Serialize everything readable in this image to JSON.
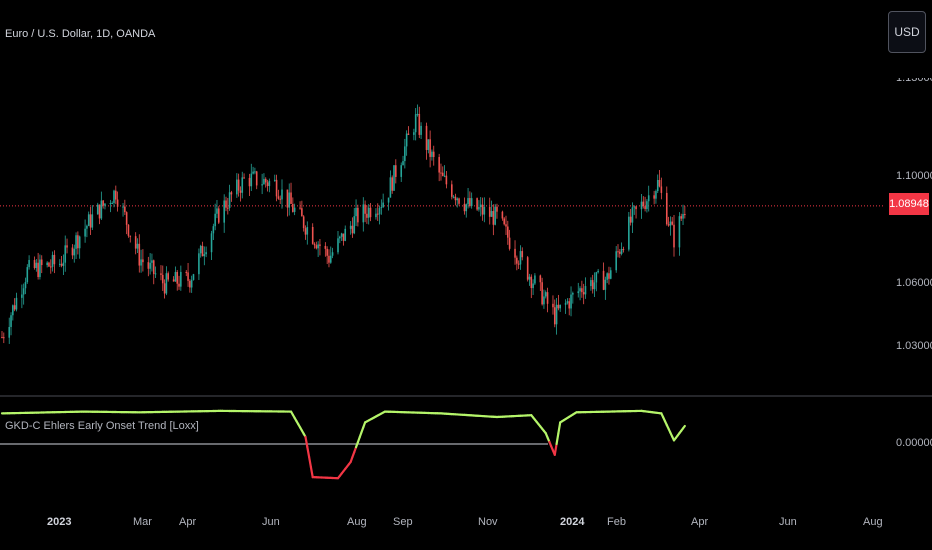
{
  "header": {
    "symbol_title": "Euro / U.S. Dollar, 1D, OANDA",
    "currency_button": "USD"
  },
  "price_pane": {
    "last_price_label": "1.08948",
    "y_axis_ticks": [
      "1.10000",
      "1.06000",
      "1.03000"
    ],
    "partially_visible_top_tick": "1.13000"
  },
  "indicator_pane": {
    "title": "GKD-C Ehlers Early Onset Trend [Loxx]",
    "y_axis_ticks": [
      "0.00000"
    ]
  },
  "time_axis": {
    "labels": [
      "2023",
      "Mar",
      "Apr",
      "Jun",
      "Aug",
      "Sep",
      "Nov",
      "2024",
      "Feb",
      "Apr",
      "Jun",
      "Aug"
    ]
  },
  "colors": {
    "background": "#000000",
    "up_candle": "#26a69a",
    "down_candle": "#ef5350",
    "price_line": "#f23645",
    "trend_up": "#b5f56a",
    "trend_down": "#f23645",
    "pane_divider": "#d1d4dc"
  },
  "chart_data": [
    {
      "type": "candlestick",
      "title": "Euro / U.S. Dollar, 1D, OANDA",
      "x_range": [
        "2022-12",
        "2023-12"
      ],
      "y_range": [
        1.02,
        1.13
      ],
      "last_price": 1.08948,
      "close_path": [
        [
          "2022-12-01",
          1.04
        ],
        [
          "2022-12-15",
          1.065
        ],
        [
          "2023-01-02",
          1.068
        ],
        [
          "2023-01-20",
          1.085
        ],
        [
          "2023-02-02",
          1.095
        ],
        [
          "2023-02-15",
          1.07
        ],
        [
          "2023-03-01",
          1.06
        ],
        [
          "2023-03-15",
          1.062
        ],
        [
          "2023-04-01",
          1.088
        ],
        [
          "2023-04-15",
          1.1
        ],
        [
          "2023-05-01",
          1.098
        ],
        [
          "2023-05-15",
          1.085
        ],
        [
          "2023-05-31",
          1.07
        ],
        [
          "2023-06-15",
          1.085
        ],
        [
          "2023-07-01",
          1.092
        ],
        [
          "2023-07-18",
          1.122
        ],
        [
          "2023-08-01",
          1.1
        ],
        [
          "2023-08-15",
          1.09
        ],
        [
          "2023-09-01",
          1.085
        ],
        [
          "2023-09-15",
          1.068
        ],
        [
          "2023-10-03",
          1.048
        ],
        [
          "2023-10-20",
          1.06
        ],
        [
          "2023-11-01",
          1.062
        ],
        [
          "2023-11-15",
          1.085
        ],
        [
          "2023-11-29",
          1.098
        ],
        [
          "2023-12-08",
          1.077
        ],
        [
          "2023-12-14",
          1.089
        ]
      ]
    },
    {
      "type": "line",
      "title": "GKD-C Ehlers Early Onset Trend [Loxx]",
      "y_zero_label": "0.00000",
      "series": [
        {
          "values_path": [
            [
              "2022-12-01",
              0.85
            ],
            [
              "2023-01-15",
              0.9
            ],
            [
              "2023-02-15",
              0.88
            ],
            [
              "2023-04-01",
              0.92
            ],
            [
              "2023-05-10",
              0.9
            ],
            [
              "2023-05-18",
              0.2
            ],
            [
              "2023-05-22",
              -0.92
            ],
            [
              "2023-06-05",
              -0.95
            ],
            [
              "2023-06-12",
              -0.5
            ],
            [
              "2023-06-20",
              0.6
            ],
            [
              "2023-07-01",
              0.9
            ],
            [
              "2023-08-01",
              0.85
            ],
            [
              "2023-09-01",
              0.75
            ],
            [
              "2023-09-20",
              0.8
            ],
            [
              "2023-09-28",
              0.3
            ],
            [
              "2023-10-03",
              -0.3
            ],
            [
              "2023-10-06",
              0.6
            ],
            [
              "2023-10-15",
              0.88
            ],
            [
              "2023-11-20",
              0.92
            ],
            [
              "2023-12-01",
              0.85
            ],
            [
              "2023-12-08",
              0.1
            ],
            [
              "2023-12-14",
              0.5
            ]
          ]
        }
      ]
    }
  ]
}
